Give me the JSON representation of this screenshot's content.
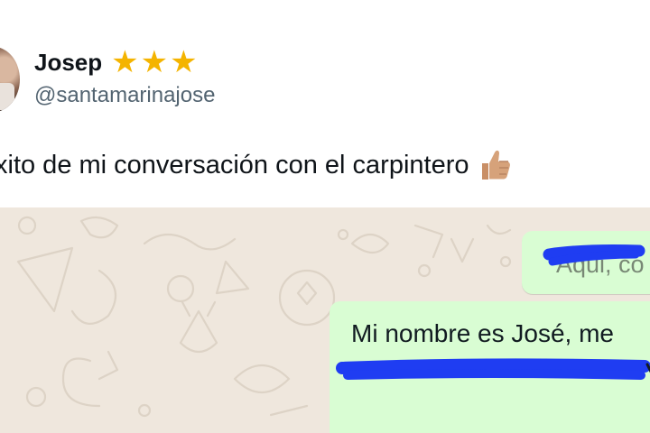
{
  "tweet": {
    "author_name": "Josep",
    "rating_icons": [
      "star-icon",
      "star-icon",
      "star-icon"
    ],
    "handle": "@santamarinajose",
    "text": "xito de mi conversación con el carpintero",
    "emoji": "thumbs-up-icon"
  },
  "chat": {
    "messages": [
      {
        "text": "Aqui, có",
        "redacted": true
      },
      {
        "text": "Mi nombre es José, me",
        "redacted_second_line": true
      }
    ]
  },
  "colors": {
    "star": "#f4b400",
    "handle": "#536471",
    "chat_background": "#efe7dd",
    "outgoing_bubble": "#d9fdd3",
    "redaction": "#1f3df2"
  }
}
